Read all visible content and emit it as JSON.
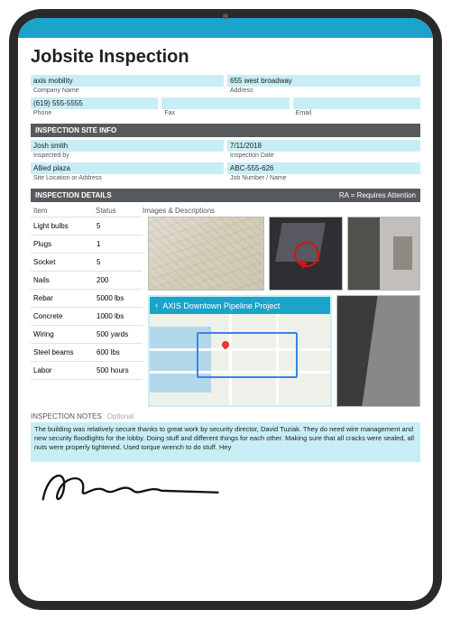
{
  "title": "Jobsite Inspection",
  "company": {
    "value": "axis mobility",
    "label": "Company Name"
  },
  "address": {
    "value": "655 west broadway",
    "label": "Address"
  },
  "phone": {
    "value": "(619) 555-5555",
    "label": "Phone"
  },
  "fax": {
    "value": "",
    "label": "Fax"
  },
  "email": {
    "value": "",
    "label": "Email"
  },
  "section_site": "INSPECTION SITE INFO",
  "inspected_by": {
    "value": "Josh smith",
    "label": "Inspected by"
  },
  "inspection_date": {
    "value": "7/11/2018",
    "label": "Inspection Date"
  },
  "site_location": {
    "value": "Allied plaza",
    "label": "Site Location or Address"
  },
  "job_number": {
    "value": "ABC-555-626",
    "label": "Job Number / Name"
  },
  "section_details": "INSPECTION DETAILS",
  "ra_hint": "RA = Requires Attention",
  "details_head": {
    "item": "Item",
    "status": "Status",
    "images": "Images & Descriptions"
  },
  "items": [
    {
      "name": "Light bulbs",
      "status": "5"
    },
    {
      "name": "Plugs",
      "status": "1"
    },
    {
      "name": "Socket",
      "status": "5"
    },
    {
      "name": "Nails",
      "status": "200"
    },
    {
      "name": "Rebar",
      "status": "5000 lbs"
    },
    {
      "name": "Concrete",
      "status": "1000 lbs"
    },
    {
      "name": "Wiring",
      "status": "500 yards"
    },
    {
      "name": "Steel beams",
      "status": "600 lbs"
    },
    {
      "name": "Labor",
      "status": "500 hours"
    }
  ],
  "map_title": "AXIS Downtown Pipeline Project",
  "notes_label": "INSPECTION NOTES",
  "notes_optional": "Optional",
  "notes": "The building was relatively secure thanks to great work by security director, David Tuziak. They do need wire management and new security floodlights for the lobby. Doing stuff and different things for each other. Making sure that all cracks were sealed, all nuts were properly tightened. Used torque wrench to do stuff. Hey"
}
